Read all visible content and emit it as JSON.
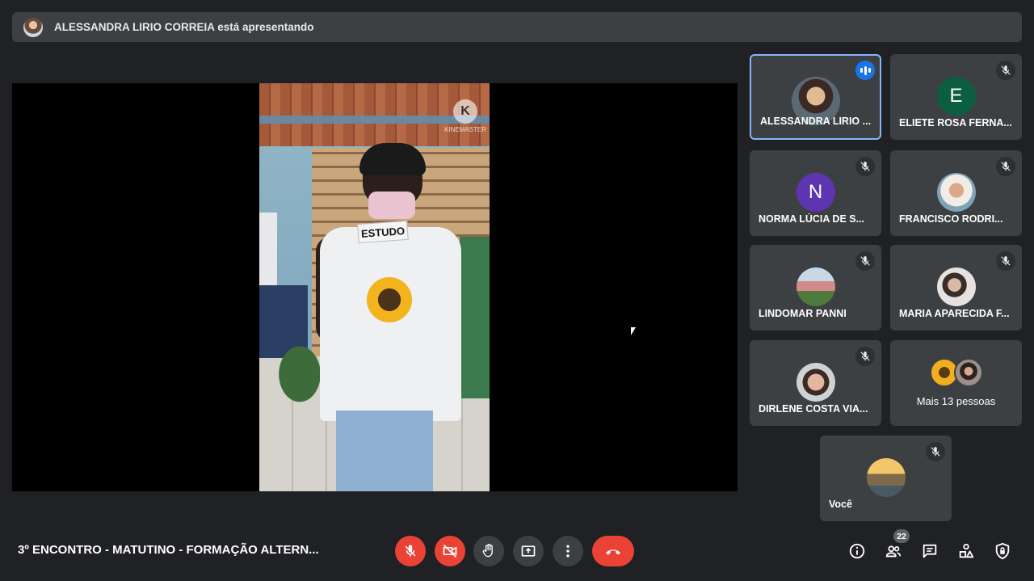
{
  "banner": {
    "presenter_text": "ALESSANDRA LIRIO CORREIA está apresentando"
  },
  "presentation": {
    "sign_text": "ESTUDO",
    "watermark_text": "KINEMASTER",
    "watermark_glyph": "K"
  },
  "participants": [
    {
      "name": "ALESSANDRA LIRIO ...",
      "initial": "",
      "speaking": true,
      "muted": false,
      "avatar_color": "#b0bec5"
    },
    {
      "name": "ELIETE ROSA FERNA...",
      "initial": "E",
      "speaking": false,
      "muted": true,
      "avatar_color": "#0b5e3f"
    },
    {
      "name": "NORMA LÚCIA DE S...",
      "initial": "N",
      "speaking": false,
      "muted": true,
      "avatar_color": "#5e35b1"
    },
    {
      "name": "FRANCISCO RODRI...",
      "initial": "",
      "speaking": false,
      "muted": true,
      "avatar_color": "#c9b7a4"
    },
    {
      "name": "LINDOMAR PANNI",
      "initial": "",
      "speaking": false,
      "muted": true,
      "avatar_color": "#6f8f5a"
    },
    {
      "name": "MARIA APARECIDA F...",
      "initial": "",
      "speaking": false,
      "muted": true,
      "avatar_color": "#d8d0cc"
    },
    {
      "name": "DIRLENE COSTA VIA...",
      "initial": "",
      "speaking": false,
      "muted": true,
      "avatar_color": "#c9a48f"
    }
  ],
  "more_people": {
    "label": "Mais 13 pessoas"
  },
  "self_tile": {
    "name": "Você"
  },
  "bottom_bar": {
    "meeting_title": "3º ENCONTRO - MATUTINO - FORMAÇÃO ALTERN...",
    "participant_count": "22"
  },
  "colors": {
    "background": "#202124",
    "tile": "#3c4043",
    "danger": "#ea4335",
    "accent": "#8ab4f8",
    "speaking": "#1a73e8"
  },
  "icons": {
    "controls": [
      "mic-off-icon",
      "camera-off-icon",
      "raise-hand-icon",
      "present-icon",
      "more-options-icon",
      "hang-up-icon"
    ],
    "right": [
      "info-icon",
      "people-icon",
      "chat-icon",
      "activities-icon",
      "host-controls-icon"
    ]
  }
}
